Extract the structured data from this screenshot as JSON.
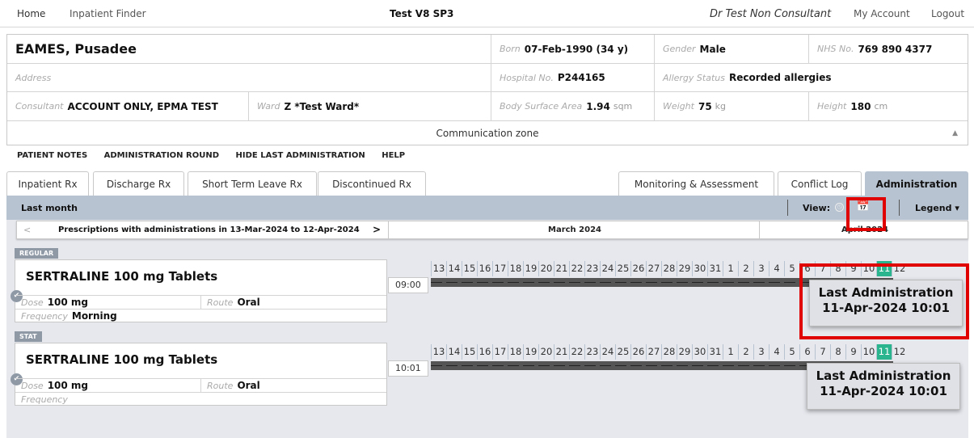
{
  "topnav": {
    "home": "Home",
    "finder": "Inpatient Finder",
    "title": "Test V8 SP3",
    "user": "Dr Test Non Consultant",
    "account": "My Account",
    "logout": "Logout"
  },
  "patient": {
    "name": "EAMES, Pusadee",
    "born_label": "Born",
    "born": "07-Feb-1990 (34 y)",
    "gender_label": "Gender",
    "gender": "Male",
    "nhs_label": "NHS No.",
    "nhs": "769 890 4377",
    "address_label": "Address",
    "hospital_label": "Hospital No.",
    "hospital": "P244165",
    "allergy_label": "Allergy Status",
    "allergy": "Recorded allergies",
    "consultant_label": "Consultant",
    "consultant": "ACCOUNT ONLY, EPMA TEST",
    "ward_label": "Ward",
    "ward": "Z *Test Ward*",
    "bsa_label": "Body Surface Area",
    "bsa": "1.94",
    "bsa_unit": "sqm",
    "weight_label": "Weight",
    "weight": "75",
    "weight_unit": "kg",
    "height_label": "Height",
    "height": "180",
    "height_unit": "cm"
  },
  "communication_zone": "Communication zone",
  "links": [
    "PATIENT NOTES",
    "ADMINISTRATION ROUND",
    "HIDE LAST ADMINISTRATION",
    "HELP"
  ],
  "tabs": [
    {
      "label": "Inpatient Rx"
    },
    {
      "label": "Discharge Rx"
    },
    {
      "label": "Short Term Leave Rx"
    },
    {
      "label": "Discontinued Rx"
    },
    {
      "label": "Monitoring & Assessment"
    },
    {
      "label": "Conflict Log"
    },
    {
      "label": "Administration",
      "active": true
    }
  ],
  "toolbar": {
    "range": "Last month",
    "view": "View:",
    "legend": "Legend ▾",
    "calendar_icon": "calendar-month-icon"
  },
  "datebar": {
    "text": "Prescriptions with administrations in 13-Mar-2024 to 12-Apr-2024",
    "month1": "March 2024",
    "month2": "April 2024"
  },
  "days": [
    "13",
    "14",
    "15",
    "16",
    "17",
    "18",
    "19",
    "20",
    "21",
    "22",
    "23",
    "24",
    "25",
    "26",
    "27",
    "28",
    "29",
    "30",
    "31",
    "1",
    "2",
    "3",
    "4",
    "5",
    "6",
    "7",
    "8",
    "9",
    "10",
    "11",
    "12"
  ],
  "today_index": 29,
  "prescriptions": [
    {
      "section": "REGULAR",
      "drug": "SERTRALINE 100 mg Tablets",
      "dose_label": "Dose",
      "dose": "100 mg",
      "route_label": "Route",
      "route": "Oral",
      "frequency_label": "Frequency",
      "frequency": "Morning",
      "time": "09:00",
      "tooltip_title": "Last Administration",
      "tooltip_date": "11-Apr-2024 10:01"
    },
    {
      "section": "STAT",
      "drug": "SERTRALINE 100 mg Tablets",
      "dose_label": "Dose",
      "dose": "100 mg",
      "route_label": "Route",
      "route": "Oral",
      "frequency_label": "Frequency",
      "frequency": "",
      "time": "10:01",
      "tooltip_title": "Last Administration",
      "tooltip_date": "11-Apr-2024 10:01"
    }
  ],
  "colors": {
    "accent": "#b8c3d1",
    "today": "#2bb58f",
    "highlight": "#e00000"
  }
}
